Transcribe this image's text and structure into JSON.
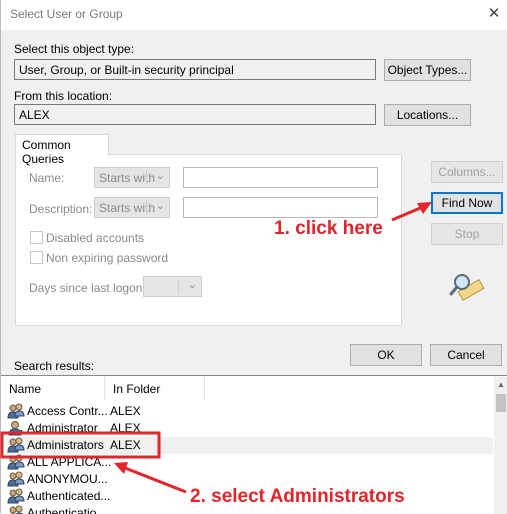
{
  "window": {
    "title": "Select User or Group",
    "close_glyph": "✕"
  },
  "object_type": {
    "label": "Select this object type:",
    "value": "User, Group, or Built-in security principal",
    "button": "Object Types..."
  },
  "location": {
    "label": "From this location:",
    "value": "ALEX",
    "button": "Locations..."
  },
  "queries": {
    "tab_label": "Common Queries",
    "name_label": "Name:",
    "name_mode": "Starts with",
    "description_label": "Description:",
    "description_mode": "Starts with",
    "disabled_accounts": "Disabled accounts",
    "non_expiring_password": "Non expiring password",
    "days_since_label": "Days since last logon:"
  },
  "side_buttons": {
    "columns": "Columns...",
    "find_now": "Find Now",
    "stop": "Stop"
  },
  "actions": {
    "ok": "OK",
    "cancel": "Cancel"
  },
  "results": {
    "label": "Search results:",
    "columns": [
      "Name",
      "In Folder"
    ],
    "rows": [
      {
        "name": "Access Contr...",
        "folder": "ALEX",
        "icon": "group-icon"
      },
      {
        "name": "Administrator",
        "folder": "ALEX",
        "icon": "user-icon"
      },
      {
        "name": "Administrators",
        "folder": "ALEX",
        "icon": "group-icon",
        "selected": true
      },
      {
        "name": "ALL APPLICA...",
        "folder": "",
        "icon": "group-icon"
      },
      {
        "name": "ANONYMOU...",
        "folder": "",
        "icon": "group-icon"
      },
      {
        "name": "Authenticated...",
        "folder": "",
        "icon": "group-icon"
      },
      {
        "name": "Authenticatio...",
        "folder": "",
        "icon": "group-icon"
      }
    ]
  },
  "annotations": {
    "step1": "1. click here",
    "step2": "2. select Administrators",
    "color": "#e3242b"
  }
}
